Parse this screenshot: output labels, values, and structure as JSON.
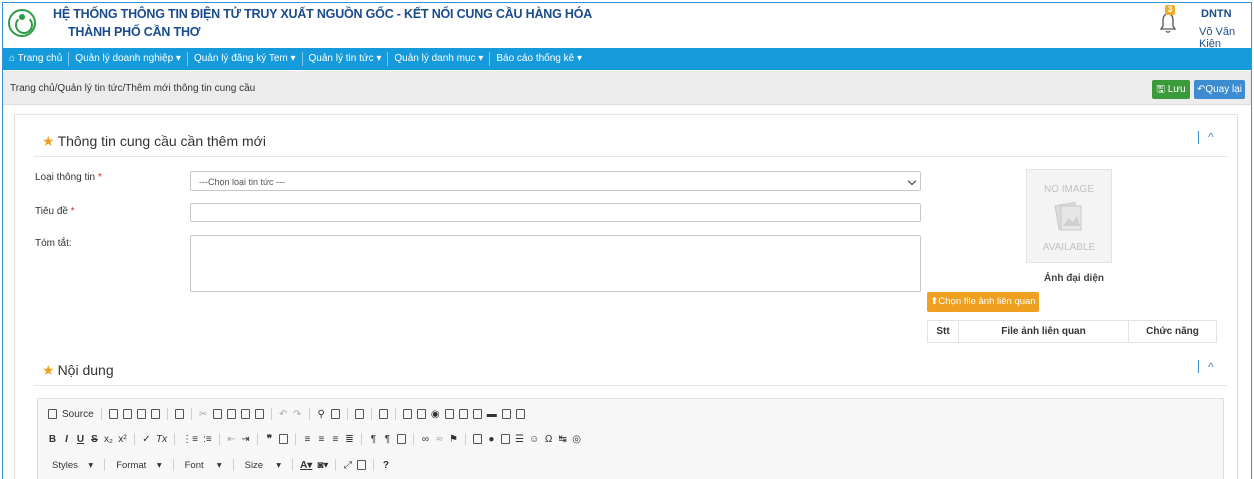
{
  "header": {
    "title_line1": "HỆ THỐNG THÔNG TIN ĐIỆN TỬ TRUY XUẤT NGUỒN GỐC - KẾT NỐI CUNG CẦU HÀNG HÓA",
    "title_line2": "THÀNH PHỐ CẦN THƠ",
    "notification_count": "3",
    "user_short": "DNTN",
    "user_name": "Võ Văn Kiện"
  },
  "nav": {
    "items": [
      "Trang chủ",
      "Quản lý doanh nghiệp ▾",
      "Quản lý đăng ký Tem ▾",
      "Quản lý tin tức ▾",
      "Quản lý danh mục ▾",
      "Báo cáo thống kê ▾"
    ]
  },
  "breadcrumb": "Trang chủ/Quản lý tin tức/Thêm mới thông tin cung cầu",
  "toolbar": {
    "save_label": "Lưu",
    "back_label": "Quay lại"
  },
  "section_info": {
    "title": "Thông tin cung cầu cần thêm mới",
    "type_label": "Loại thông tin",
    "type_value": "---Chọn loại tin tức ---",
    "title_label": "Tiêu đề",
    "summary_label": "Tóm tắt:",
    "required_mark": "*"
  },
  "image": {
    "no_image_top": "NO IMAGE",
    "no_image_bottom": "AVAILABLE",
    "avatar_label": "Ảnh đại diện",
    "choose_file_label": "Chọn file ảnh liên quan",
    "table_headers": [
      "Stt",
      "File ảnh liên quan",
      "Chức năng"
    ]
  },
  "section_content": {
    "title": "Nội dung"
  },
  "editor": {
    "source_label": "Source",
    "styles_label": "Styles",
    "format_label": "Format",
    "font_label": "Font",
    "size_label": "Size"
  },
  "colors": {
    "nav_bg": "#159bdb",
    "title_blue": "#1a4c8c",
    "save_green": "#3b9a3b",
    "back_blue": "#3d8bd0",
    "accent_orange": "#f0a020"
  }
}
